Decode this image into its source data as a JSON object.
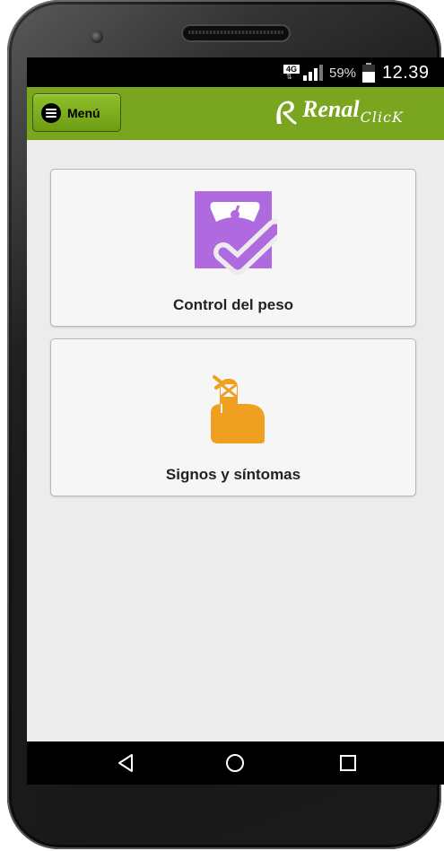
{
  "status_bar": {
    "network": "4G",
    "battery_percent": "59%",
    "battery_level": 0.59,
    "time": "12.39"
  },
  "app_bar": {
    "menu_label": "Menú",
    "logo_main": "Renal",
    "logo_sub": "ClicK"
  },
  "cards": [
    {
      "label": "Control del peso",
      "icon": "weight-scale-check-icon",
      "icon_color": "#b06ae0"
    },
    {
      "label": "Signos y síntomas",
      "icon": "bandaged-finger-icon",
      "icon_color": "#f0a020"
    }
  ],
  "colors": {
    "app_bar": "#7aa51f",
    "screen_background": "#ececec"
  },
  "nav_bar": [
    "back-icon",
    "home-icon",
    "recents-icon"
  ]
}
